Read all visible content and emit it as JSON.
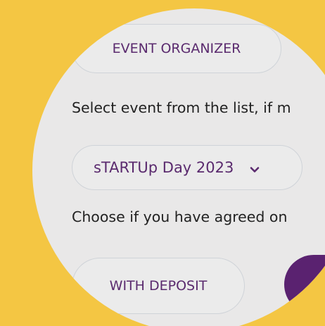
{
  "buttons": {
    "organizer_label": "EVENT ORGANIZER",
    "deposit_label": "WITH DEPOSIT"
  },
  "labels": {
    "select_event": "Select event from the list, if m",
    "choose_agreement": "Choose if you have agreed on"
  },
  "event_select": {
    "selected_value": "sTARTUp Day 2023",
    "chevron_icon": "chevron-down-icon"
  },
  "colors": {
    "background": "#f4c643",
    "lens": "#e9e8e8",
    "accent_purple": "#5a2270",
    "button_text": "#5a2a6e"
  }
}
